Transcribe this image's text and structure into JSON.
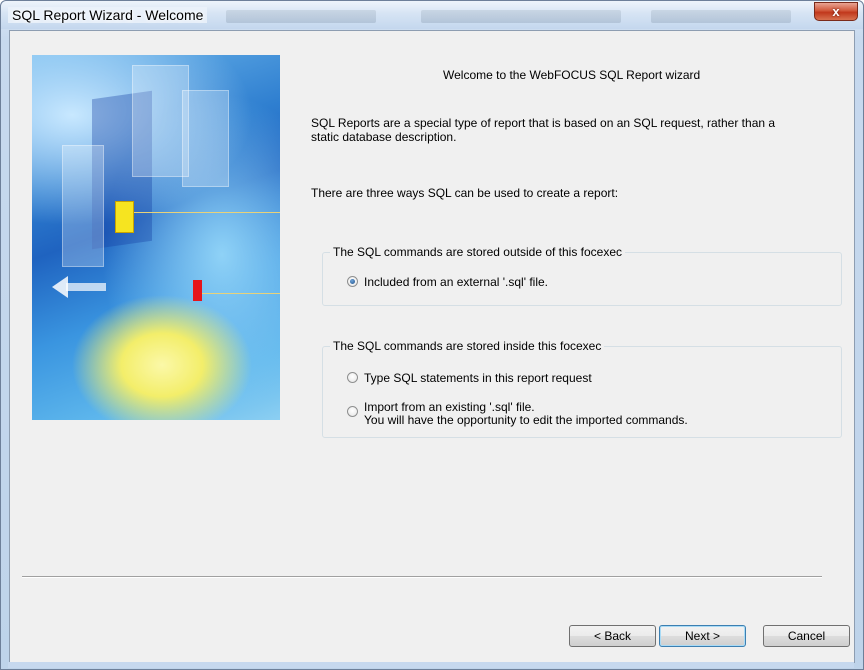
{
  "window": {
    "title": "SQL Report Wizard - Welcome",
    "close_glyph": "x",
    "close_icon": "close-icon"
  },
  "content": {
    "heading": "Welcome to the WebFOCUS SQL Report wizard",
    "intro_line1": "SQL Reports are a special type of report that is based on an SQL request, rather than a",
    "intro_line2": "static database description.",
    "ways_text": "There are three ways SQL can be used to create a report:"
  },
  "groups": {
    "outside": {
      "label": "The SQL commands are stored outside of this focexec",
      "options": [
        {
          "label": "Included from an external '.sql' file.",
          "checked": true
        }
      ]
    },
    "inside": {
      "label": "The SQL commands are stored inside this focexec",
      "options": [
        {
          "label": "Type SQL statements in this report request",
          "checked": false
        },
        {
          "label": "Import from an existing '.sql' file.",
          "sublabel": "You will have the opportunity to edit the imported commands.",
          "checked": false
        }
      ]
    }
  },
  "buttons": {
    "back": "< Back",
    "next": "Next >",
    "cancel": "Cancel"
  },
  "colors": {
    "accent": "#3c7fb1",
    "client_bg": "#f0f0f0",
    "close_red": "#c1381c"
  }
}
